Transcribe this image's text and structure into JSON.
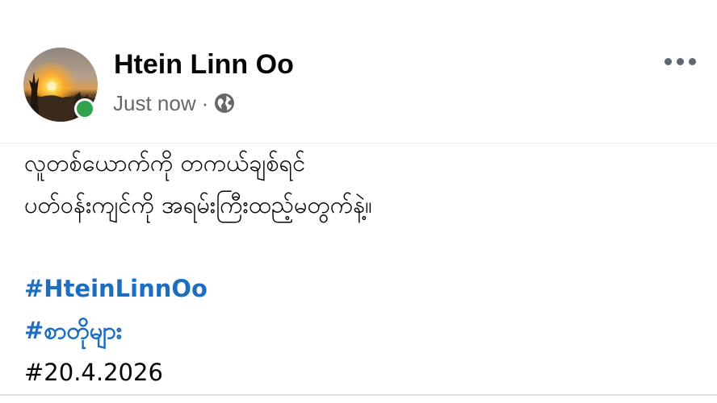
{
  "post": {
    "author": {
      "name": "Htein Linn Oo",
      "online_status_color": "#31a24c"
    },
    "timestamp": "Just now",
    "separator": "·",
    "audience_icon": "globe-icon",
    "more_menu_icon": "more-horizontal-icon",
    "body_lines": [
      "လူတစ်ယောက်ကို တကယ်ချစ်ရင်",
      "ပတ်ဝန်းကျင်ကို အရမ်းကြီးထည့်မတွက်နဲ့။"
    ],
    "hashtags": [
      {
        "text": "#HteinLinnOo",
        "color": "#1b6ec2"
      },
      {
        "text": "#စာတိုများ",
        "color": "#1b6ec2"
      },
      {
        "text": "#20.4.2026",
        "color": "#050505"
      }
    ]
  },
  "colors": {
    "text": "#050505",
    "secondary_text": "#65676b",
    "link": "#1b6ec2"
  }
}
